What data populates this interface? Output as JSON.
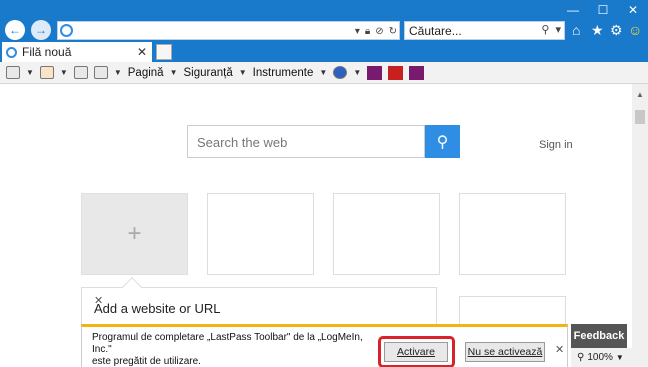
{
  "address_bar": {
    "value": ""
  },
  "search_box": {
    "placeholder": "Căutare..."
  },
  "tab": {
    "title": "Filă nouă"
  },
  "command_bar": {
    "page_menu": "Pagină",
    "security_menu": "Siguranță",
    "tools_menu": "Instrumente"
  },
  "new_tab_page": {
    "web_search_placeholder": "Search the web",
    "sign_in": "Sign in",
    "add_popup_text": "Add a website or URL"
  },
  "notification": {
    "message_line1": "Programul de completare „LastPass Toolbar\" de la „LogMeIn, Inc.\"",
    "message_line2": "este pregătit de utilizare.",
    "activate_label": "Activare",
    "deny_label": "Nu se activează"
  },
  "feedback_label": "Feedback",
  "zoom_level": "100%",
  "colors": {
    "accent": "#1979ca",
    "notification_bar": "#f3b413",
    "highlight": "#d9232a"
  }
}
